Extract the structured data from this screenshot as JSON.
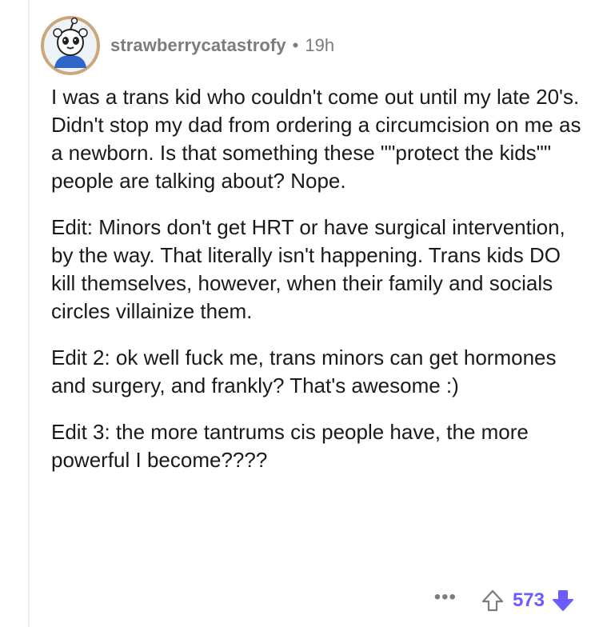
{
  "comment": {
    "author": "strawberrycatastrofy",
    "separator": "•",
    "time": "19h",
    "paragraphs": [
      "I was a trans kid who couldn't come out until my late 20's. Didn't stop my dad from ordering a circumcision on me as a newborn. Is that something these \"\"protect the kids\"\" people are talking about? Nope.",
      "Edit: Minors don't get HRT or have surgical intervention, by the way. That literally isn't happening. Trans kids DO kill themselves, however, when their family and socials circles villainize them.",
      "Edit 2: ok well fuck me, trans minors can get hormones and surgery, and frankly? That's awesome :)",
      "Edit 3: the more tantrums cis people have, the more powerful I become????"
    ],
    "more_label": "•••",
    "score": "573"
  },
  "icons": {
    "avatar": "snoo-avatar-icon",
    "upvote": "upvote-arrow-icon",
    "downvote": "downvote-arrow-icon"
  },
  "colors": {
    "muted_text": "#7c7c7c",
    "body_text": "#1a1a1b",
    "upvoted": "#6a5cff",
    "thread_line": "#edeff1"
  }
}
